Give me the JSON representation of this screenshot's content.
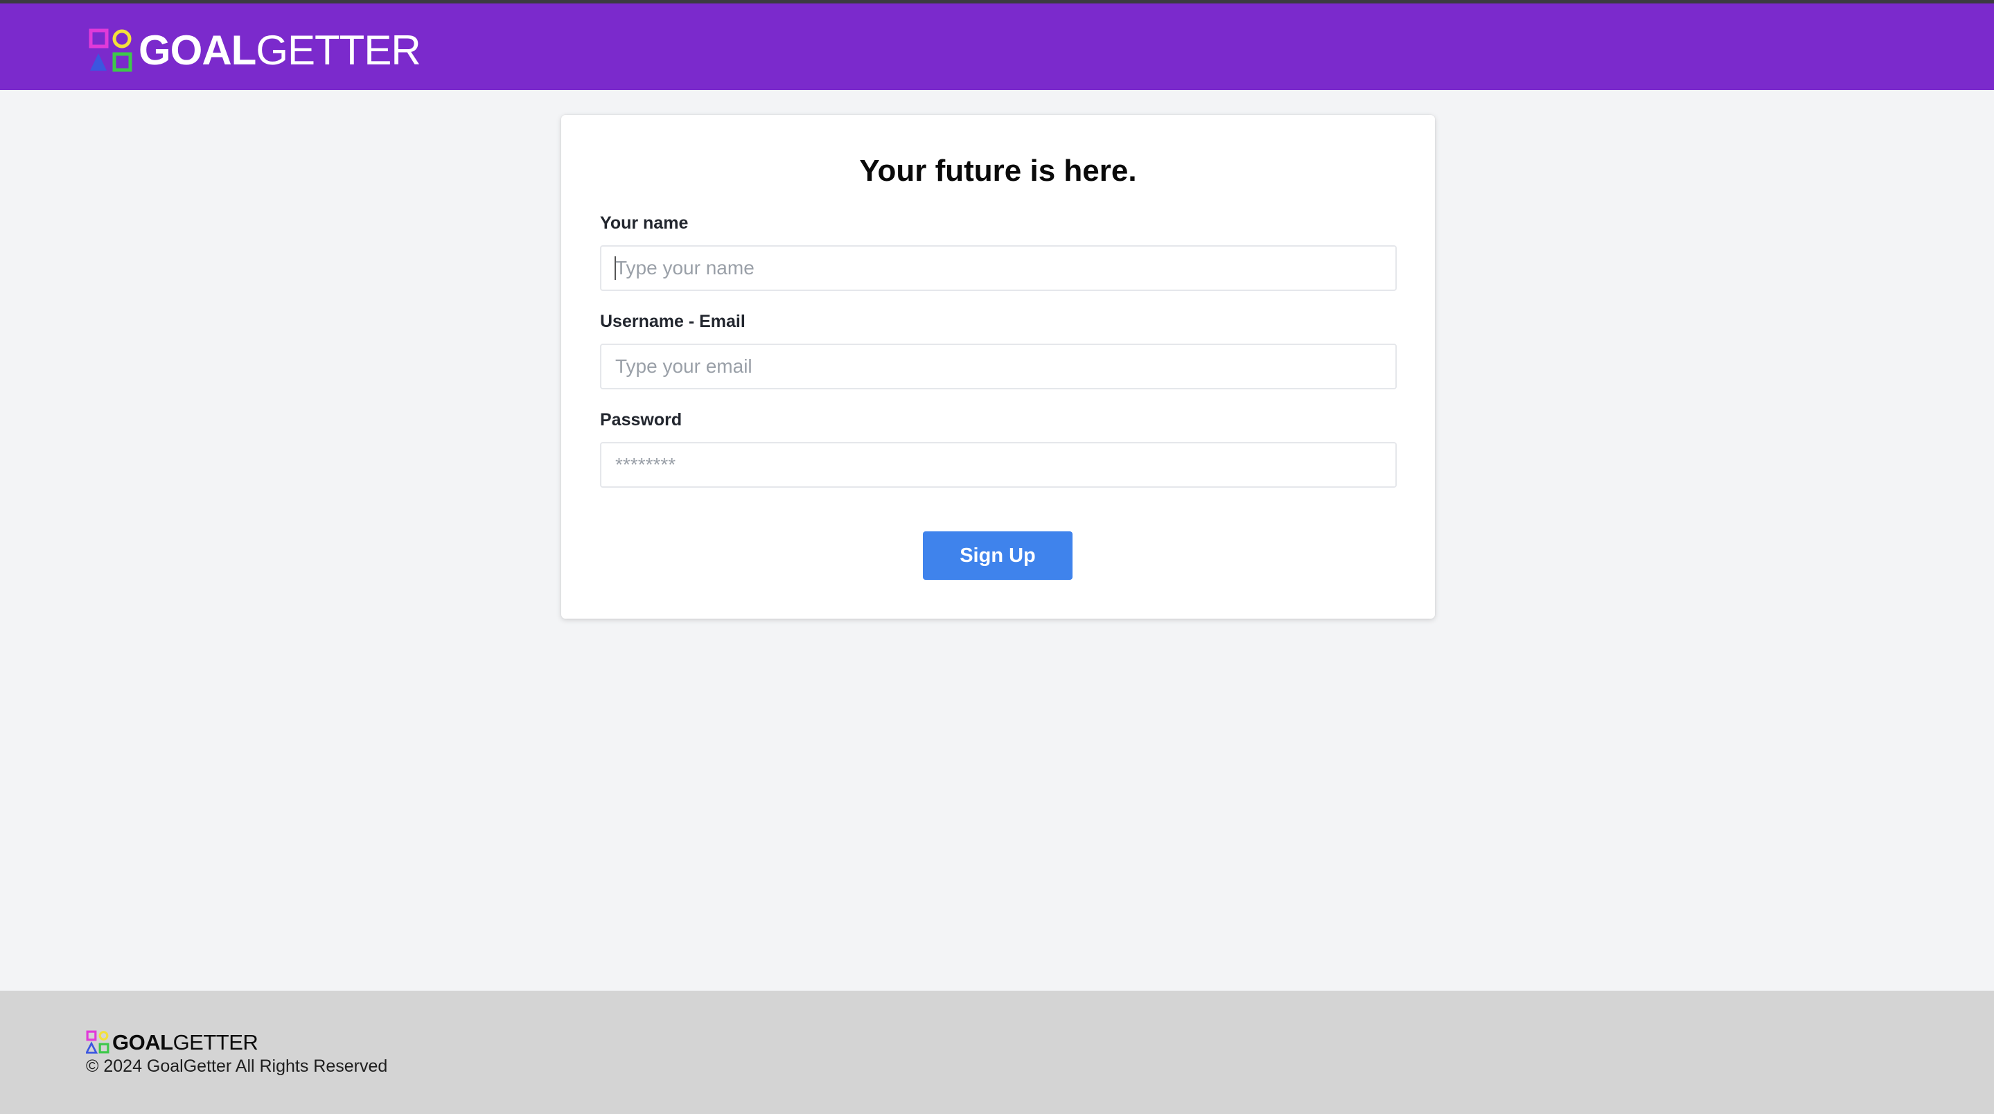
{
  "brand": {
    "name_bold": "GOAL",
    "name_light": "GETTER",
    "colors": {
      "header_bg": "#7b2acc",
      "mark_square": "#e13ad9",
      "mark_circle": "#f3e13b",
      "mark_triangle": "#3b56e0",
      "mark_square2": "#3ec84a"
    }
  },
  "form": {
    "title": "Your future is here.",
    "name_label": "Your name",
    "name_placeholder": "Type your name",
    "email_label": "Username - Email",
    "email_placeholder": "Type your email",
    "password_label": "Password",
    "password_placeholder": "********",
    "submit_label": "Sign Up",
    "submit_color": "#3f83ec"
  },
  "footer": {
    "logo_bold": "GOAL",
    "logo_light": "GETTER",
    "copyright": "© 2024 GoalGetter All Rights Reserved"
  },
  "icons": {
    "brand_logo": "logo-shapes-icon",
    "footer_logo": "logo-shapes-icon"
  }
}
